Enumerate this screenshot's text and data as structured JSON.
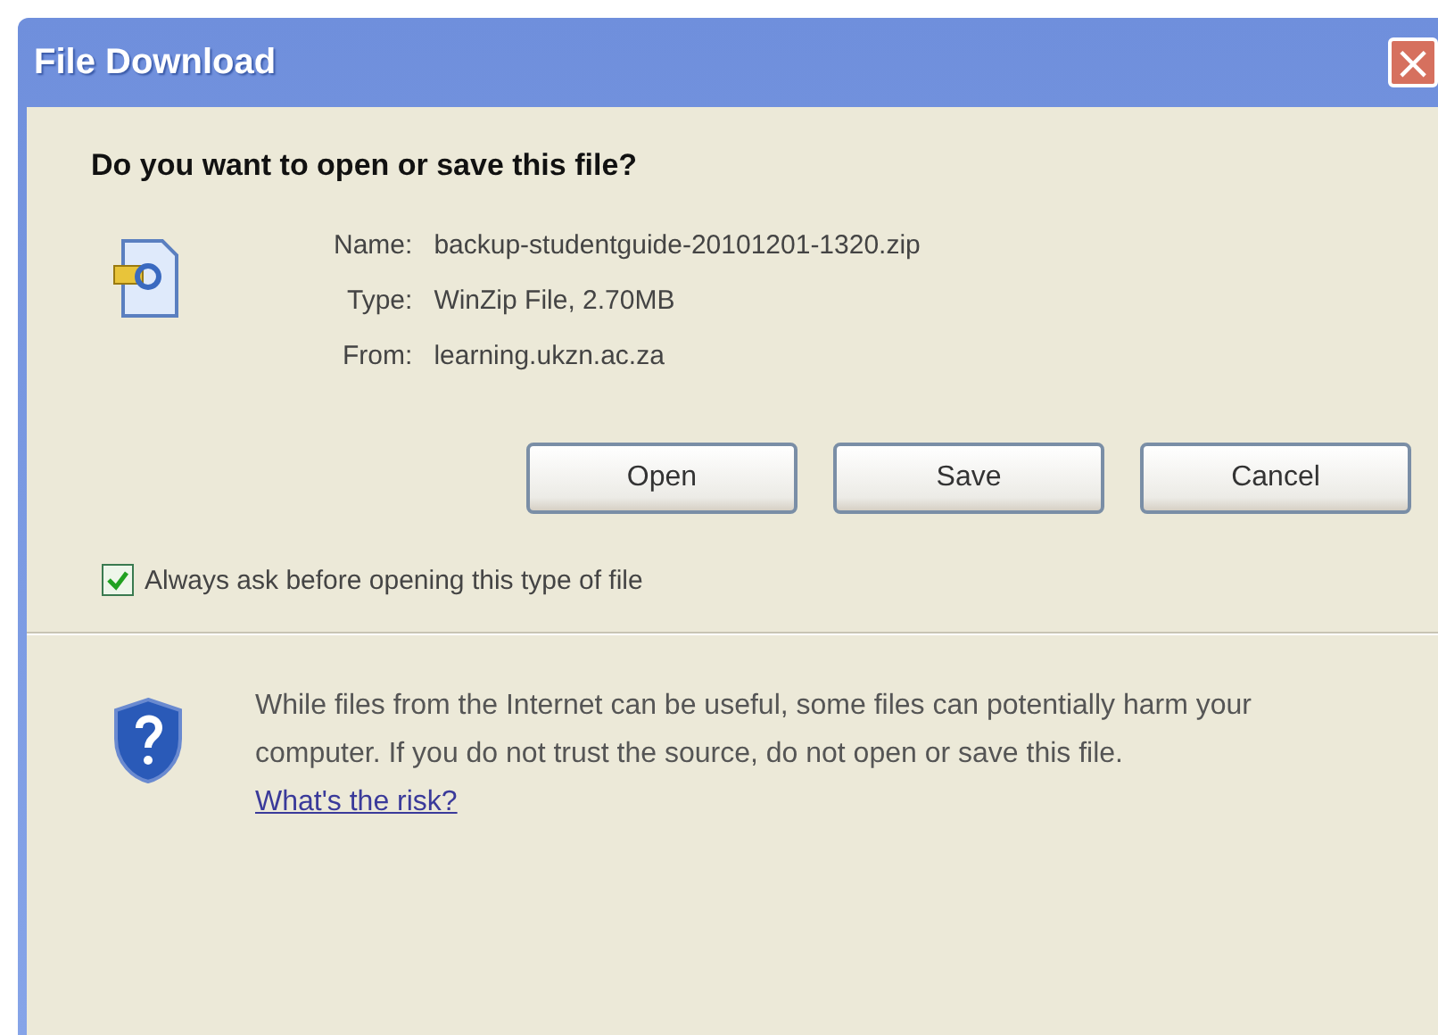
{
  "window": {
    "title": "File Download",
    "close": "×"
  },
  "question": "Do you want to open or save this file?",
  "fields": [
    {
      "label": "Name:",
      "value": "backup-studentguide-20101201-1320.zip"
    },
    {
      "label": "Type:",
      "value": "WinZip File, 2.70MB"
    },
    {
      "label": "From:",
      "value": "learning.ukzn.ac.za"
    }
  ],
  "buttons": [
    "Open",
    "Save",
    "Cancel"
  ],
  "always_ask": {
    "label": "Always ask before opening this type of file",
    "checked": true
  },
  "warning": {
    "text": "While files from the Internet can be useful, some files can potentially harm your computer. If you do not trust the source, do not open or save this file.",
    "link": "What's the risk?"
  }
}
